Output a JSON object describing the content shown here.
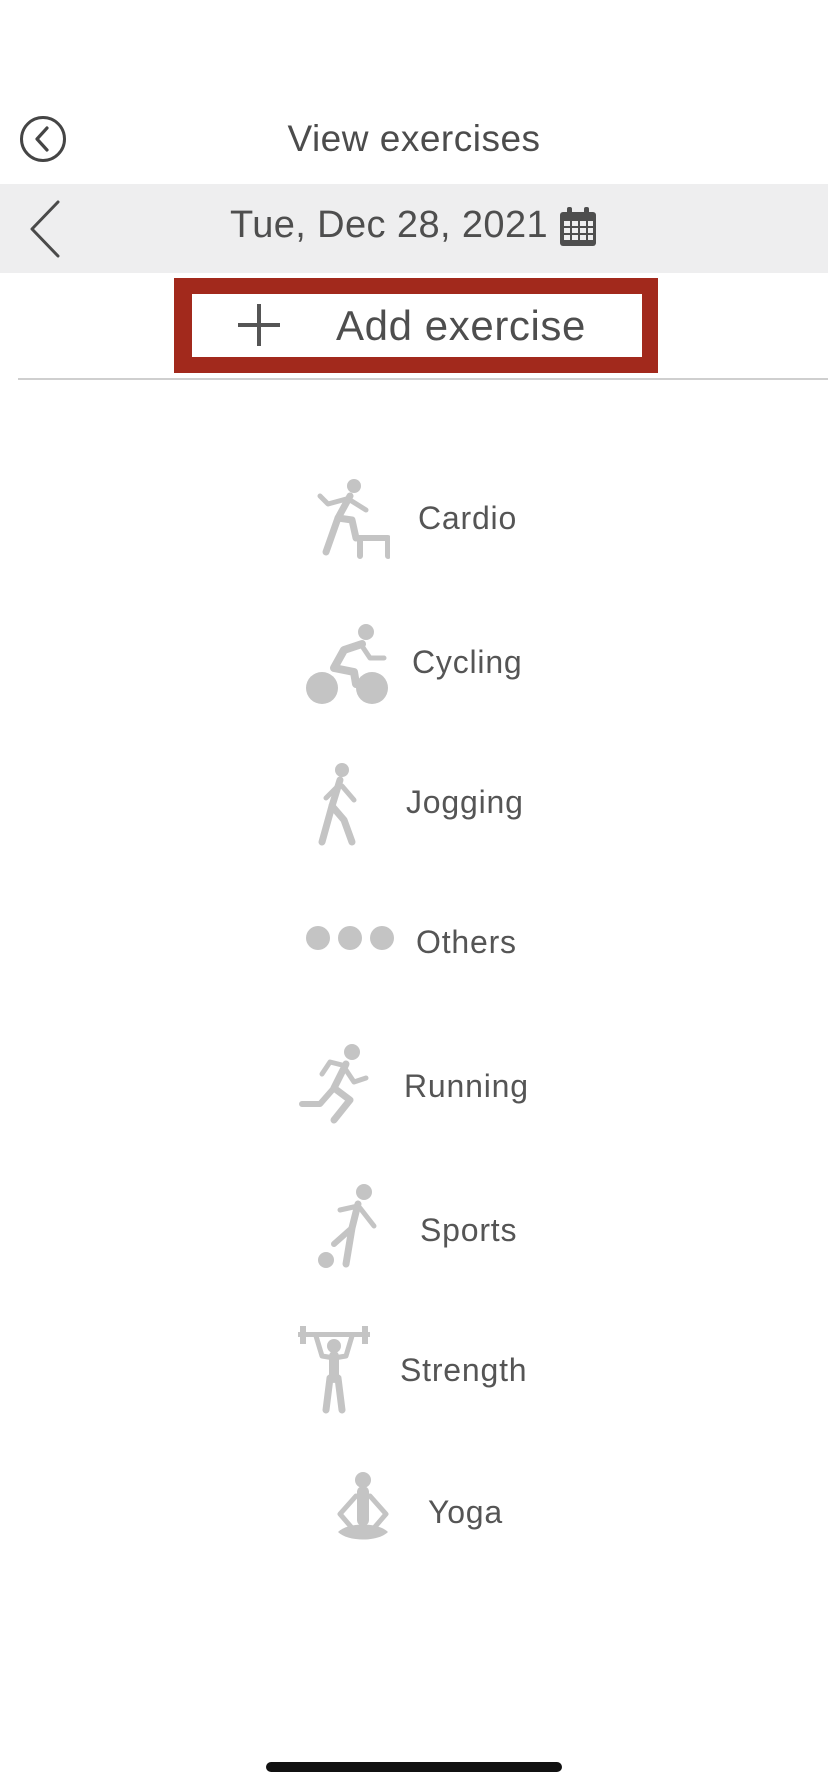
{
  "header": {
    "title": "View exercises"
  },
  "date_bar": {
    "date": "Tue, Dec 28, 2021"
  },
  "add_button": {
    "label": "Add exercise"
  },
  "exercises": [
    {
      "label": "Cardio",
      "icon": "cardio-icon"
    },
    {
      "label": "Cycling",
      "icon": "cycling-icon"
    },
    {
      "label": "Jogging",
      "icon": "jogging-icon"
    },
    {
      "label": "Others",
      "icon": "others-icon"
    },
    {
      "label": "Running",
      "icon": "running-icon"
    },
    {
      "label": "Sports",
      "icon": "sports-icon"
    },
    {
      "label": "Strength",
      "icon": "strength-icon"
    },
    {
      "label": "Yoga",
      "icon": "yoga-icon"
    }
  ],
  "colors": {
    "accent": "#a2291c",
    "icon_gray": "#c4c4c4",
    "date_bar_bg": "#eeeeef"
  }
}
